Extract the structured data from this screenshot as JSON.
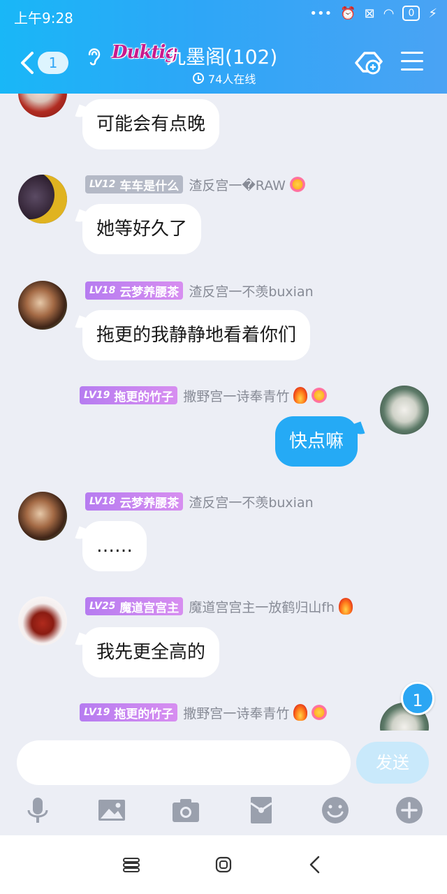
{
  "status_bar": {
    "time": "上午9:28",
    "battery": "0"
  },
  "header": {
    "back_count": "1",
    "logo_text": "Duktig",
    "group_title": "九墨阁(102)",
    "online_text": "74人在线"
  },
  "messages": [
    {
      "text": "可能会有点晚"
    },
    {
      "level": "LV12",
      "title": "车车是什么",
      "nick": "渣反宫一�RAW",
      "text": "她等好久了"
    },
    {
      "level": "LV18",
      "title": "云梦养腰茶",
      "nick": "渣反宫一不羡buxian",
      "text": "拖更的我静静地看着你们"
    },
    {
      "level": "LV19",
      "title": "拖更的竹子",
      "nick": "撒野宫一诗奉青竹",
      "text": "快点嘛"
    },
    {
      "level": "LV18",
      "title": "云梦养腰茶",
      "nick": "渣反宫一不羡buxian",
      "text": "……"
    },
    {
      "level": "LV25",
      "title": "魔道宫宫主",
      "nick": "魔道宫宫主一放鹤归山fh",
      "text": "我先更全高的"
    },
    {
      "level": "LV19",
      "title": "拖更的竹子",
      "nick": "撒野宫一诗奉青竹"
    }
  ],
  "unread_count": "1",
  "input": {
    "placeholder": "",
    "send_label": "发送"
  },
  "colors": {
    "header_start": "#19b7f7",
    "bubble_self": "#25aaf5",
    "badge_purple": "#c384f0",
    "badge_gray": "#b4b9c6"
  }
}
